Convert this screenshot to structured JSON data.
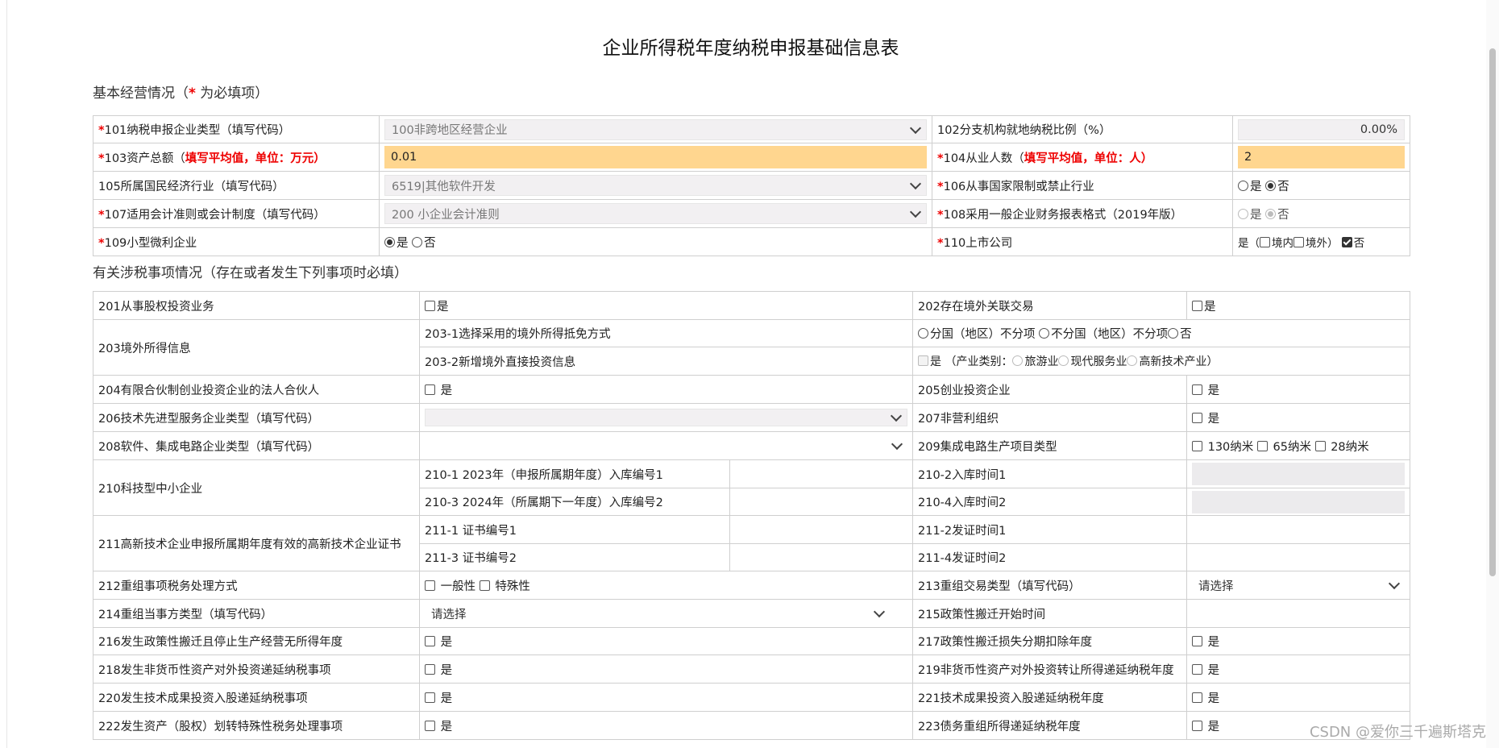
{
  "title": "企业所得税年度纳税申报基础信息表",
  "section1": {
    "pre": "基本经营情况（",
    "star": "*",
    "post": " 为必填项）"
  },
  "section2": "有关涉税事项情况（存在或者发生下列事项时必填）",
  "r101": {
    "label": "101纳税申报企业类型（填写代码）",
    "value": "100非跨地区经营企业"
  },
  "r102": {
    "label": "102分支机构就地纳税比例（%）",
    "value": "0.00%"
  },
  "r103": {
    "label": "103资产总额（",
    "note": "填写平均值，单位：万元",
    "close": "）",
    "value": "0.01"
  },
  "r104": {
    "label": "104从业人数（",
    "note": "填写平均值，单位：人",
    "close": "）",
    "value": "2"
  },
  "r105": {
    "label": "105所属国民经济行业（填写代码）",
    "value": "6519|其他软件开发"
  },
  "r106": {
    "label": "106从事国家限制或禁止行业",
    "yes": "是",
    "no": "否"
  },
  "r107": {
    "label": "107适用会计准则或会计制度（填写代码）",
    "value": "200 小企业会计准则"
  },
  "r108": {
    "label": "108采用一般企业财务报表格式（2019年版）",
    "yes": "是",
    "no": "否"
  },
  "r109": {
    "label": "109小型微利企业",
    "yes": "是",
    "no": "否"
  },
  "r110": {
    "label": "110上市公司",
    "yes": "是（",
    "domestic": "境内",
    "overseas": "境外）",
    "no": "否"
  },
  "r201": {
    "label": "201从事股权投资业务",
    "opt": "是"
  },
  "r202": {
    "label": "202存在境外关联交易",
    "opt": "是"
  },
  "r203": {
    "label": "203境外所得信息",
    "sub1": "203-1选择采用的境外所得抵免方式",
    "a": "分国（地区）不分项",
    "b": "不分国（地区）不分项",
    "c": "否",
    "sub2": "203-2新增境外直接投资信息",
    "d": "是 （产业类别：",
    "e": "旅游业",
    "f": "现代服务业",
    "g": "高新技术产业）"
  },
  "r204": {
    "label": "204有限合伙制创业投资企业的法人合伙人",
    "opt": "是"
  },
  "r205": {
    "label": "205创业投资企业",
    "opt": "是"
  },
  "r206": {
    "label": "206技术先进型服务企业类型（填写代码）"
  },
  "r207": {
    "label": "207非营利组织",
    "opt": "是"
  },
  "r208": {
    "label": "208软件、集成电路企业类型（填写代码）"
  },
  "r209": {
    "label": "209集成电路生产项目类型",
    "a": "130纳米",
    "b": "65纳米",
    "c": "28纳米"
  },
  "r210": {
    "label": "210科技型中小企业",
    "s1": "210-1  2023年（申报所属期年度）入库编号1",
    "s2": "210-2入库时间1",
    "s3": "210-3  2024年（所属期下一年度）入库编号2",
    "s4": "210-4入库时间2"
  },
  "r211": {
    "label": "211高新技术企业申报所属期年度有效的高新技术企业证书",
    "s1": "211-1 证书编号1",
    "s2": "211-2发证时间1",
    "s3": "211-3 证书编号2",
    "s4": "211-4发证时间2"
  },
  "r212": {
    "label": "212重组事项税务处理方式",
    "a": "一般性",
    "b": "特殊性"
  },
  "r213": {
    "label": "213重组交易类型（填写代码）",
    "value": "请选择"
  },
  "r214": {
    "label": "214重组当事方类型（填写代码）",
    "value": "请选择"
  },
  "r215": {
    "label": "215政策性搬迁开始时间"
  },
  "r216": {
    "label": "216发生政策性搬迁且停止生产经营无所得年度",
    "opt": "是"
  },
  "r217": {
    "label": "217政策性搬迁损失分期扣除年度",
    "opt": "是"
  },
  "r218": {
    "label": "218发生非货币性资产对外投资递延纳税事项",
    "opt": "是"
  },
  "r219": {
    "label": "219非货币性资产对外投资转让所得递延纳税年度",
    "opt": "是"
  },
  "r220": {
    "label": "220发生技术成果投资入股递延纳税事项",
    "opt": "是"
  },
  "r221": {
    "label": "221技术成果投资入股递延纳税年度",
    "opt": "是"
  },
  "r222": {
    "label": "222发生资产（股权）划转特殊性税务处理事项",
    "opt": "是"
  },
  "r223": {
    "label": "223债务重组所得递延纳税年度",
    "opt": "是"
  },
  "watermark": "CSDN @爱你三千遍斯塔克",
  "icons": [
    "chevron-down-icon",
    "checkbox-icon",
    "radio-icon"
  ],
  "colors": {
    "highlight": "#ffd68f",
    "required": "#e00000",
    "disabled_bg": "#f2f0f2"
  }
}
